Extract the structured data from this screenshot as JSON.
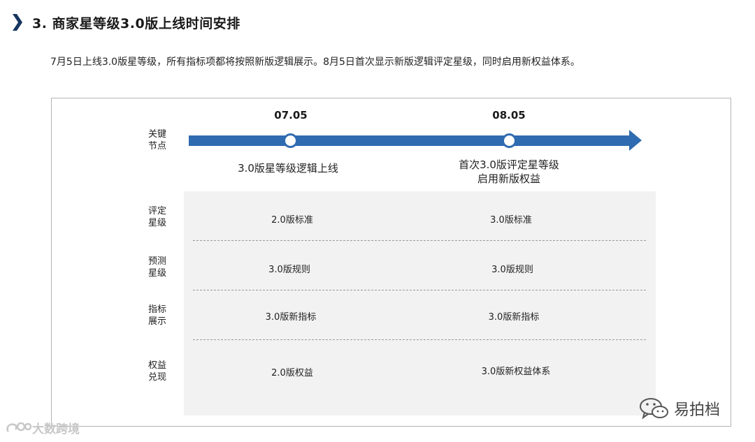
{
  "header": {
    "title": "3. 商家星等级3.0版上线时间安排",
    "intro": "7月5日上线3.0版星等级，所有指标项都将按照新版逻辑展示。8月5日首次显示新版逻辑评定星级，同时启用新权益体系。"
  },
  "timeline": {
    "row_label_line1": "关键",
    "row_label_line2": "节点",
    "milestones": [
      {
        "date": "07.05",
        "caption_line1": "3.0版星等级逻辑上线",
        "caption_line2": ""
      },
      {
        "date": "08.05",
        "caption_line1": "首次3.0版评定星等级",
        "caption_line2": "启用新版权益"
      }
    ],
    "accent_color": "#2f6bb0"
  },
  "table": {
    "rows": [
      {
        "label_line1": "评定",
        "label_line2": "星级",
        "col1": "2.0版标准",
        "col2": "3.0版标准"
      },
      {
        "label_line1": "预测",
        "label_line2": "星级",
        "col1": "3.0版规则",
        "col2": "3.0版规则"
      },
      {
        "label_line1": "指标",
        "label_line2": "展示",
        "col1": "3.0版新指标",
        "col2": "3.0版新指标"
      },
      {
        "label_line1": "权益",
        "label_line2": "兑现",
        "col1": "2.0版权益",
        "col2": "3.0版新权益体系"
      }
    ]
  },
  "watermarks": {
    "left": "大数跨境",
    "right": "易拍档",
    "left_icon": "weibo-icon",
    "right_icon": "wechat-icon"
  }
}
